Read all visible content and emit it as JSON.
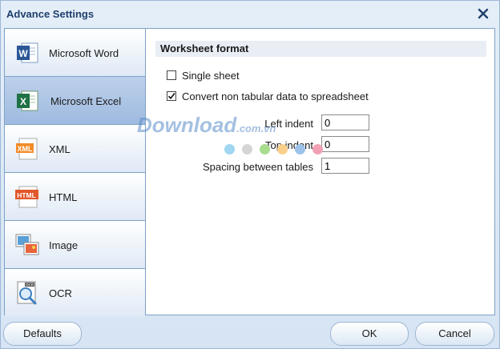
{
  "window": {
    "title": "Advance Settings"
  },
  "sidebar": {
    "items": [
      {
        "label": "Microsoft Word",
        "icon": "word-icon"
      },
      {
        "label": "Microsoft Excel",
        "icon": "excel-icon",
        "active": true
      },
      {
        "label": "XML",
        "icon": "xml-icon"
      },
      {
        "label": "HTML",
        "icon": "html-icon"
      },
      {
        "label": "Image",
        "icon": "image-icon"
      },
      {
        "label": "OCR",
        "icon": "ocr-icon"
      }
    ]
  },
  "content": {
    "section_title": "Worksheet format",
    "single_sheet": {
      "label": "Single sheet",
      "checked": false
    },
    "convert_non_tabular": {
      "label": "Convert non tabular data to spreadsheet",
      "checked": true
    },
    "left_indent": {
      "label": "Left indent",
      "value": "0"
    },
    "top_indent": {
      "label": "Top indent",
      "value": "0"
    },
    "spacing_between_tables": {
      "label": "Spacing between tables",
      "value": "1"
    }
  },
  "watermark": {
    "text": "Download",
    "suffix": ".com.vn"
  },
  "buttons": {
    "defaults": "Defaults",
    "ok": "OK",
    "cancel": "Cancel"
  },
  "colors": {
    "accent": "#1f3f6b",
    "active_item": "#a9c2e3",
    "border": "#7fa1c8"
  }
}
